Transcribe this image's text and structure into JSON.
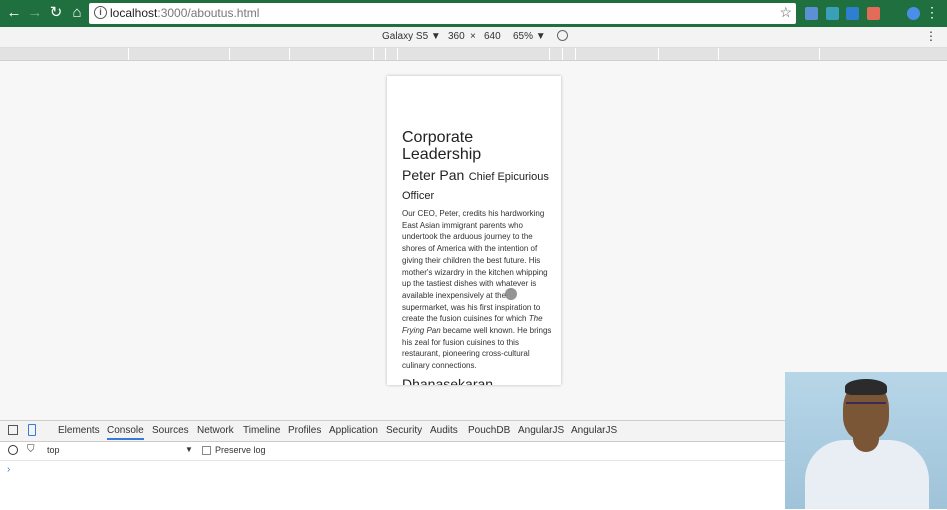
{
  "browser": {
    "url_host": "localhost",
    "url_path": ":3000/aboutus.html"
  },
  "device_toolbar": {
    "device": "Galaxy S5",
    "width": "360",
    "times": "×",
    "height": "640",
    "zoom": "65%"
  },
  "page": {
    "section_heading": "Corporate Leadership",
    "person1_name": "Peter Pan",
    "person1_title": "Chief Epicurious Officer",
    "bio_before_em": "Our CEO, Peter, credits his hardworking East Asian immigrant parents who undertook the arduous journey to the shores of America with the intention of giving their children the best future. His mother's wizardry in the kitchen whipping up the tastiest dishes with whatever is available inexpensively at the supermarket, was his first inspiration to create the fusion cuisines for which ",
    "bio_em": "The Frying Pan",
    "bio_after_em": " became well known. He brings his zeal for fusion cuisines to this restaurant, pioneering cross-cultural culinary connections.",
    "person2_name": "Dhanasekaran"
  },
  "devtools": {
    "tabs": [
      "Elements",
      "Console",
      "Sources",
      "Network",
      "Timeline",
      "Profiles",
      "Application",
      "Security",
      "Audits",
      "PouchDB",
      "AngularJS",
      "AngularJS"
    ],
    "active_tab": "Console",
    "context": "top",
    "preserve_log": "Preserve log",
    "prompt": "›"
  },
  "colors": {
    "chrome_bar": "#1f6f3f",
    "active_tab_underline": "#3879d9"
  }
}
